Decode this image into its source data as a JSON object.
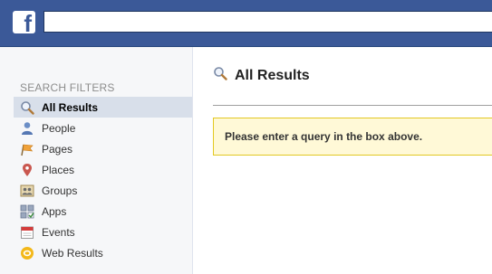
{
  "header": {
    "logo_letter": "f",
    "search_placeholder": ""
  },
  "sidebar": {
    "title": "SEARCH FILTERS",
    "items": [
      {
        "label": "All Results",
        "icon": "magnifier-icon",
        "active": true
      },
      {
        "label": "People",
        "icon": "person-icon"
      },
      {
        "label": "Pages",
        "icon": "flag-icon"
      },
      {
        "label": "Places",
        "icon": "map-pin-icon"
      },
      {
        "label": "Groups",
        "icon": "group-icon"
      },
      {
        "label": "Apps",
        "icon": "apps-icon"
      },
      {
        "label": "Events",
        "icon": "calendar-icon"
      },
      {
        "label": "Web Results",
        "icon": "web-icon"
      }
    ]
  },
  "main": {
    "title": "All Results",
    "notice": "Please enter a query in the box above."
  },
  "colors": {
    "topbar": "#3b5998",
    "active_filter": "#d8dfea",
    "notice_bg": "#fff9d7",
    "notice_border": "#e2c822"
  }
}
